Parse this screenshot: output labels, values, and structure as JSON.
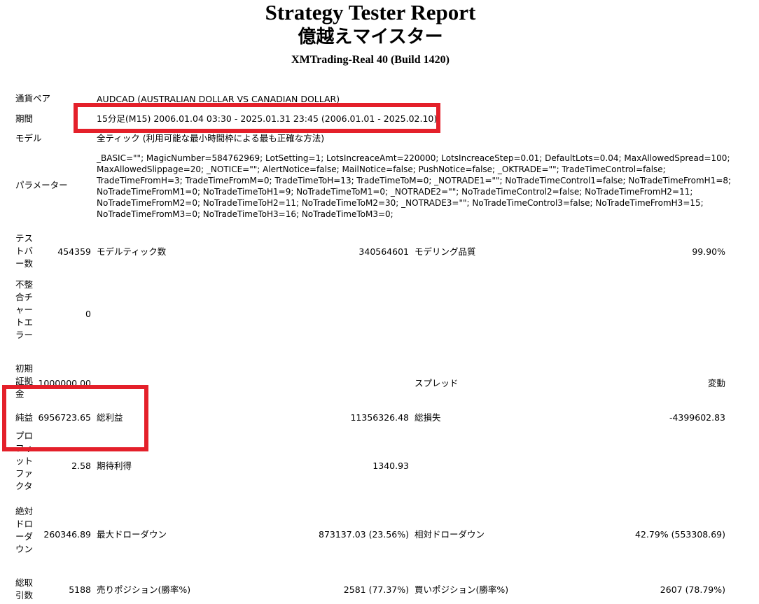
{
  "header": {
    "title": "Strategy Tester Report",
    "subtitle": "億越えマイスター",
    "server": "XMTrading-Real 40 (Build 1420)"
  },
  "settings": {
    "symbol_label": "通貨ペア",
    "symbol_value": "AUDCAD (AUSTRALIAN DOLLAR VS CANADIAN DOLLAR)",
    "period_label": "期間",
    "period_value": "15分足(M15) 2006.01.04 03:30 - 2025.01.31 23:45 (2006.01.01 - 2025.02.10)",
    "model_label": "モデル",
    "model_value": "全ティック (利用可能な最小時間枠による最も正確な方法)",
    "params_label": "パラメーター",
    "params_value": "_BASIC=\"\"; MagicNumber=584762969; LotSetting=1; LotsIncreaceAmt=220000; LotsIncreaceStep=0.01; DefaultLots=0.04; MaxAllowedSpread=100;\nMaxAllowedSlippage=20; _NOTICE=\"\"; AlertNotice=false; MailNotice=false; PushNotice=false; _OKTRADE=\"\"; TradeTimeControl=false;\nTradeTimeFromH=3; TradeTimeFromM=0; TradeTimeToH=13; TradeTimeToM=0; _NOTRADE1=\"\"; NoTradeTimeControl1=false; NoTradeTimeFromH1=8;\nNoTradeTimeFromM1=0; NoTradeTimeToH1=9; NoTradeTimeToM1=0; _NOTRADE2=\"\"; NoTradeTimeControl2=false; NoTradeTimeFromH2=11;\nNoTradeTimeFromM2=0; NoTradeTimeToH2=11; NoTradeTimeToM2=30; _NOTRADE3=\"\"; NoTradeTimeControl3=false; NoTradeTimeFromH3=15;\nNoTradeTimeFromM3=0; NoTradeTimeToH3=16; NoTradeTimeToM3=0;"
  },
  "stats": {
    "bars_label": [
      "テス",
      "トバ",
      "ー数"
    ],
    "bars_value": "454359",
    "ticks_label": "モデルティック数",
    "ticks_value": "340564601",
    "quality_label": "モデリング品質",
    "quality_value": "99.90%",
    "mismatch_label": [
      "不整",
      "合チ",
      "ャー",
      "トエ",
      "ラー"
    ],
    "mismatch_value": "0",
    "deposit_label": [
      "初期",
      "証拠",
      "金"
    ],
    "deposit_value": "1000000.00",
    "spread_label": "スプレッド",
    "spread_value": "変動",
    "net_label": "純益",
    "net_value": "6956723.65",
    "gross_profit_label": "総利益",
    "gross_profit_value": "11356326.48",
    "gross_loss_label": "総損失",
    "gross_loss_value": "-4399602.83",
    "pf_label": [
      "プロ",
      "フィ",
      "ット",
      "ファ",
      "クタ"
    ],
    "pf_value": "2.58",
    "payoff_label": "期待利得",
    "payoff_value": "1340.93",
    "abs_dd_label": [
      "絶対",
      "ドロ",
      "ーダ",
      "ウン"
    ],
    "abs_dd_value": "260346.89",
    "max_dd_label": "最大ドローダウン",
    "max_dd_value": "873137.03 (23.56%)",
    "rel_dd_label": "相対ドローダウン",
    "rel_dd_value": "42.79% (553308.69)",
    "trades_label": [
      "総取",
      "引数"
    ],
    "trades_value": "5188",
    "short_label": "売りポジション(勝率%)",
    "short_value": "2581 (77.37%)",
    "long_label": "買いポジション(勝率%)",
    "long_value": "2607 (78.79%)"
  },
  "highlight_color": "#e4202a"
}
